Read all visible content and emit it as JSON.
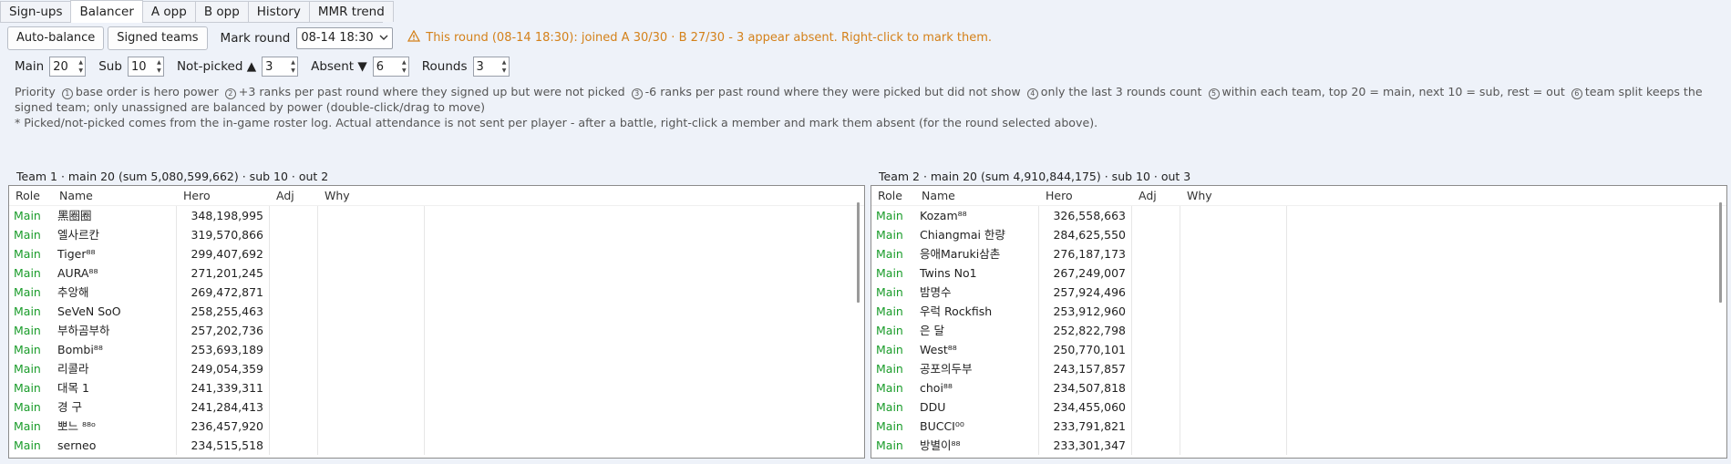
{
  "tabs": [
    {
      "label": "Sign-ups",
      "active": false
    },
    {
      "label": "Balancer",
      "active": true
    },
    {
      "label": "A opp",
      "active": false
    },
    {
      "label": "B opp",
      "active": false
    },
    {
      "label": "History",
      "active": false
    },
    {
      "label": "MMR trend",
      "active": false
    }
  ],
  "toolbar": {
    "auto_balance_label": "Auto-balance",
    "signed_teams_label": "Signed teams",
    "mark_round_label": "Mark round",
    "mark_round_value": "08-14 18:30",
    "warning": "This round (08-14 18:30): joined A 30/30 · B 27/30 - 3 appear absent. Right-click to mark them.",
    "warning_color": "#d4811a"
  },
  "settings": {
    "main_label": "Main",
    "main_value": "20",
    "sub_label": "Sub",
    "sub_value": "10",
    "notpicked_label": "Not-picked ▲",
    "notpicked_value": "3",
    "absent_label": "Absent ▼",
    "absent_value": "6",
    "rounds_label": "Rounds",
    "rounds_value": "3"
  },
  "info": {
    "priority_label": "Priority",
    "p1": "base order is hero power",
    "p2": "+3 ranks per past round where they signed up but were not picked",
    "p3": "-6 ranks per past round where they were picked but did not show",
    "p4": "only the last 3 rounds count",
    "p5": "within each team, top 20 = main, next 10 = sub, rest = out",
    "p6": "team split keeps the signed team; only unassigned are balanced by power (double-click/drag to move)",
    "note": "* Picked/not-picked comes from the in-game roster log. Actual attendance is not sent per player - after a battle, right-click a member and mark them absent (for the round selected above)."
  },
  "columns": {
    "role": "Role",
    "name": "Name",
    "hero": "Hero",
    "adj": "Adj",
    "why": "Why"
  },
  "role_color": "#1a9c2a",
  "team1": {
    "header": "Team 1 · main 20 (sum 5,080,599,662) · sub 10 · out 2",
    "rows": [
      {
        "role": "Main",
        "name": "黑圈圈",
        "hero": "348,198,995"
      },
      {
        "role": "Main",
        "name": "엘사르칸",
        "hero": "319,570,866"
      },
      {
        "role": "Main",
        "name": "Tiger⁸⁸",
        "hero": "299,407,692"
      },
      {
        "role": "Main",
        "name": "AURA⁸⁸",
        "hero": "271,201,245"
      },
      {
        "role": "Main",
        "name": "추앙해",
        "hero": "269,472,871"
      },
      {
        "role": "Main",
        "name": "SeVeN SoO",
        "hero": "258,255,463"
      },
      {
        "role": "Main",
        "name": "부하곰부하",
        "hero": "257,202,736"
      },
      {
        "role": "Main",
        "name": "Bombi⁸⁸",
        "hero": "253,693,189"
      },
      {
        "role": "Main",
        "name": "리콜라",
        "hero": "249,054,359"
      },
      {
        "role": "Main",
        "name": "대목 1",
        "hero": "241,339,311"
      },
      {
        "role": "Main",
        "name": "경 구",
        "hero": "241,284,413"
      },
      {
        "role": "Main",
        "name": "뽀느 ⁸⁸ᵒ",
        "hero": "236,457,920"
      },
      {
        "role": "Main",
        "name": "serneo",
        "hero": "234,515,518"
      }
    ]
  },
  "team2": {
    "header": "Team 2 · main 20 (sum 4,910,844,175) · sub 10 · out 3",
    "rows": [
      {
        "role": "Main",
        "name": "Kozam⁸⁸",
        "hero": "326,558,663"
      },
      {
        "role": "Main",
        "name": "Chiangmai 한량",
        "hero": "284,625,550"
      },
      {
        "role": "Main",
        "name": "응애Maruki삼촌",
        "hero": "276,187,173"
      },
      {
        "role": "Main",
        "name": "Twins No1",
        "hero": "267,249,007"
      },
      {
        "role": "Main",
        "name": "밤명수",
        "hero": "257,924,496"
      },
      {
        "role": "Main",
        "name": "우럭 Rockfish",
        "hero": "253,912,960"
      },
      {
        "role": "Main",
        "name": "은 달",
        "hero": "252,822,798"
      },
      {
        "role": "Main",
        "name": "West⁸⁸",
        "hero": "250,770,101"
      },
      {
        "role": "Main",
        "name": "공포의두부",
        "hero": "243,157,857"
      },
      {
        "role": "Main",
        "name": "choi⁸⁸",
        "hero": "234,507,818"
      },
      {
        "role": "Main",
        "name": "DDU",
        "hero": "234,455,060"
      },
      {
        "role": "Main",
        "name": "BUCCI⁰⁰",
        "hero": "233,791,821"
      },
      {
        "role": "Main",
        "name": "방별이⁸⁸",
        "hero": "233,301,347"
      }
    ]
  }
}
